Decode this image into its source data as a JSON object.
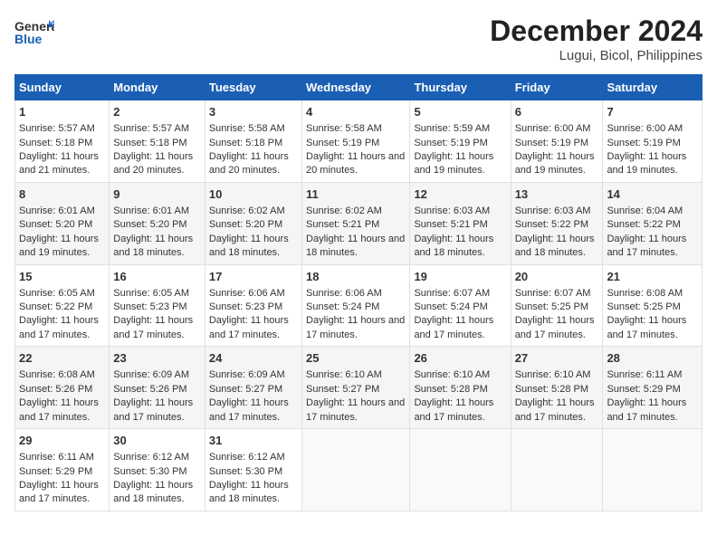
{
  "header": {
    "logo_line1": "General",
    "logo_line2": "Blue",
    "title": "December 2024",
    "subtitle": "Lugui, Bicol, Philippines"
  },
  "days_of_week": [
    "Sunday",
    "Monday",
    "Tuesday",
    "Wednesday",
    "Thursday",
    "Friday",
    "Saturday"
  ],
  "weeks": [
    [
      {
        "day": "1",
        "sunrise": "5:57 AM",
        "sunset": "5:18 PM",
        "daylight": "11 hours and 21 minutes."
      },
      {
        "day": "2",
        "sunrise": "5:57 AM",
        "sunset": "5:18 PM",
        "daylight": "11 hours and 20 minutes."
      },
      {
        "day": "3",
        "sunrise": "5:58 AM",
        "sunset": "5:18 PM",
        "daylight": "11 hours and 20 minutes."
      },
      {
        "day": "4",
        "sunrise": "5:58 AM",
        "sunset": "5:19 PM",
        "daylight": "11 hours and 20 minutes."
      },
      {
        "day": "5",
        "sunrise": "5:59 AM",
        "sunset": "5:19 PM",
        "daylight": "11 hours and 19 minutes."
      },
      {
        "day": "6",
        "sunrise": "6:00 AM",
        "sunset": "5:19 PM",
        "daylight": "11 hours and 19 minutes."
      },
      {
        "day": "7",
        "sunrise": "6:00 AM",
        "sunset": "5:19 PM",
        "daylight": "11 hours and 19 minutes."
      }
    ],
    [
      {
        "day": "8",
        "sunrise": "6:01 AM",
        "sunset": "5:20 PM",
        "daylight": "11 hours and 19 minutes."
      },
      {
        "day": "9",
        "sunrise": "6:01 AM",
        "sunset": "5:20 PM",
        "daylight": "11 hours and 18 minutes."
      },
      {
        "day": "10",
        "sunrise": "6:02 AM",
        "sunset": "5:20 PM",
        "daylight": "11 hours and 18 minutes."
      },
      {
        "day": "11",
        "sunrise": "6:02 AM",
        "sunset": "5:21 PM",
        "daylight": "11 hours and 18 minutes."
      },
      {
        "day": "12",
        "sunrise": "6:03 AM",
        "sunset": "5:21 PM",
        "daylight": "11 hours and 18 minutes."
      },
      {
        "day": "13",
        "sunrise": "6:03 AM",
        "sunset": "5:22 PM",
        "daylight": "11 hours and 18 minutes."
      },
      {
        "day": "14",
        "sunrise": "6:04 AM",
        "sunset": "5:22 PM",
        "daylight": "11 hours and 17 minutes."
      }
    ],
    [
      {
        "day": "15",
        "sunrise": "6:05 AM",
        "sunset": "5:22 PM",
        "daylight": "11 hours and 17 minutes."
      },
      {
        "day": "16",
        "sunrise": "6:05 AM",
        "sunset": "5:23 PM",
        "daylight": "11 hours and 17 minutes."
      },
      {
        "day": "17",
        "sunrise": "6:06 AM",
        "sunset": "5:23 PM",
        "daylight": "11 hours and 17 minutes."
      },
      {
        "day": "18",
        "sunrise": "6:06 AM",
        "sunset": "5:24 PM",
        "daylight": "11 hours and 17 minutes."
      },
      {
        "day": "19",
        "sunrise": "6:07 AM",
        "sunset": "5:24 PM",
        "daylight": "11 hours and 17 minutes."
      },
      {
        "day": "20",
        "sunrise": "6:07 AM",
        "sunset": "5:25 PM",
        "daylight": "11 hours and 17 minutes."
      },
      {
        "day": "21",
        "sunrise": "6:08 AM",
        "sunset": "5:25 PM",
        "daylight": "11 hours and 17 minutes."
      }
    ],
    [
      {
        "day": "22",
        "sunrise": "6:08 AM",
        "sunset": "5:26 PM",
        "daylight": "11 hours and 17 minutes."
      },
      {
        "day": "23",
        "sunrise": "6:09 AM",
        "sunset": "5:26 PM",
        "daylight": "11 hours and 17 minutes."
      },
      {
        "day": "24",
        "sunrise": "6:09 AM",
        "sunset": "5:27 PM",
        "daylight": "11 hours and 17 minutes."
      },
      {
        "day": "25",
        "sunrise": "6:10 AM",
        "sunset": "5:27 PM",
        "daylight": "11 hours and 17 minutes."
      },
      {
        "day": "26",
        "sunrise": "6:10 AM",
        "sunset": "5:28 PM",
        "daylight": "11 hours and 17 minutes."
      },
      {
        "day": "27",
        "sunrise": "6:10 AM",
        "sunset": "5:28 PM",
        "daylight": "11 hours and 17 minutes."
      },
      {
        "day": "28",
        "sunrise": "6:11 AM",
        "sunset": "5:29 PM",
        "daylight": "11 hours and 17 minutes."
      }
    ],
    [
      {
        "day": "29",
        "sunrise": "6:11 AM",
        "sunset": "5:29 PM",
        "daylight": "11 hours and 17 minutes."
      },
      {
        "day": "30",
        "sunrise": "6:12 AM",
        "sunset": "5:30 PM",
        "daylight": "11 hours and 18 minutes."
      },
      {
        "day": "31",
        "sunrise": "6:12 AM",
        "sunset": "5:30 PM",
        "daylight": "11 hours and 18 minutes."
      },
      null,
      null,
      null,
      null
    ]
  ]
}
